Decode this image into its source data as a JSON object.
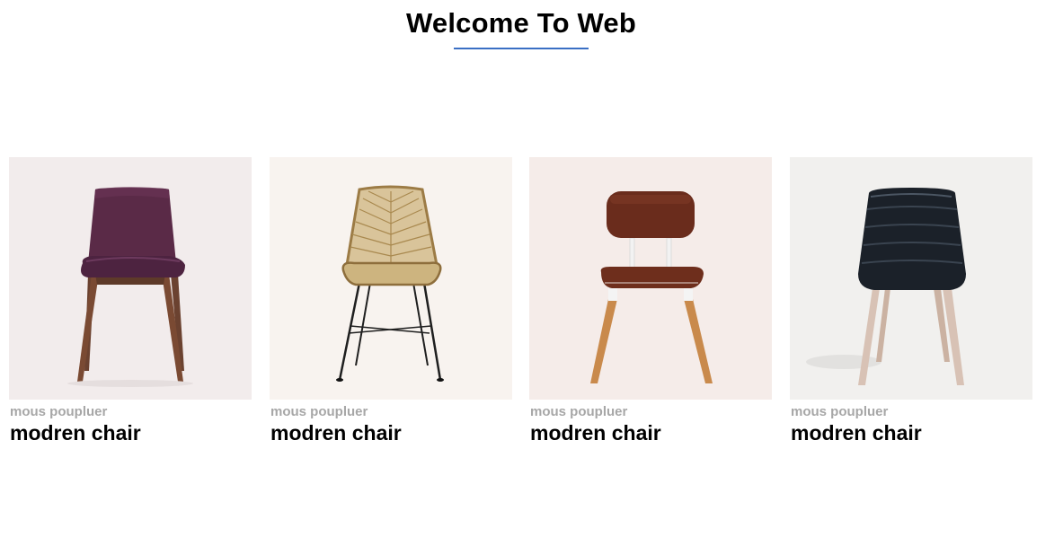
{
  "header": {
    "title": "Welcome To Web"
  },
  "colors": {
    "title_underline": "#3a6fc4",
    "subtitle_text": "#a7a7a7"
  },
  "products": [
    {
      "subtitle": "mous poupluer",
      "title": "modren chair",
      "image": "purple-upholstered-chair-walnut-legs",
      "background": "#f2ecec"
    },
    {
      "subtitle": "mous poupluer",
      "title": "modren chair",
      "image": "rattan-chair-black-metal-legs",
      "background": "#f8f3ef"
    },
    {
      "subtitle": "mous poupluer",
      "title": "modren chair",
      "image": "brown-leather-chair-wood-legs",
      "background": "#f5ece9"
    },
    {
      "subtitle": "mous poupluer",
      "title": "modren chair",
      "image": "black-quilted-chair-light-wood-legs",
      "background": "#f1f0ee"
    }
  ]
}
